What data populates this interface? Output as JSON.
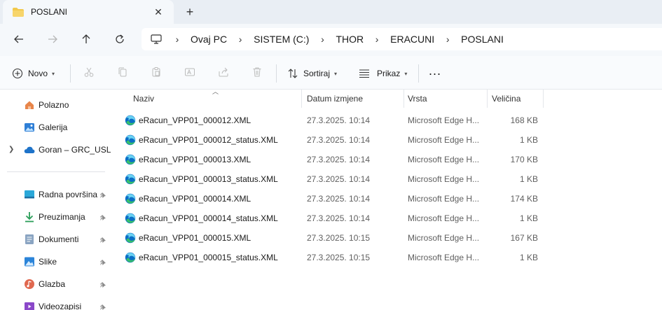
{
  "window": {
    "tab_title": "POSLANI"
  },
  "breadcrumb": {
    "items": [
      "Ovaj PC",
      "SISTEM (C:)",
      "THOR",
      "ERACUNI",
      "POSLANI"
    ]
  },
  "toolbar": {
    "new_label": "Novo",
    "sort_label": "Sortiraj",
    "view_label": "Prikaz",
    "more_label": "..."
  },
  "sidebar": {
    "items": [
      {
        "label": "Polazno",
        "icon": "home-icon"
      },
      {
        "label": "Galerija",
        "icon": "gallery-icon"
      },
      {
        "label": "Goran – GRC_USLUGE",
        "icon": "onedrive-cloud-icon"
      },
      {
        "label": "Radna površina",
        "icon": "desktop-icon"
      },
      {
        "label": "Preuzimanja",
        "icon": "download-icon"
      },
      {
        "label": "Dokumenti",
        "icon": "document-icon"
      },
      {
        "label": "Slike",
        "icon": "pictures-icon"
      },
      {
        "label": "Glazba",
        "icon": "music-icon"
      },
      {
        "label": "Videozapisi",
        "icon": "video-icon"
      }
    ]
  },
  "columns": {
    "name": "Naziv",
    "date": "Datum izmjene",
    "type": "Vrsta",
    "size": "Veličina"
  },
  "files": [
    {
      "name": "eRacun_VPP01_000012.XML",
      "date": "27.3.2025. 10:14",
      "type": "Microsoft Edge H...",
      "size": "168 KB"
    },
    {
      "name": "eRacun_VPP01_000012_status.XML",
      "date": "27.3.2025. 10:14",
      "type": "Microsoft Edge H...",
      "size": "1 KB"
    },
    {
      "name": "eRacun_VPP01_000013.XML",
      "date": "27.3.2025. 10:14",
      "type": "Microsoft Edge H...",
      "size": "170 KB"
    },
    {
      "name": "eRacun_VPP01_000013_status.XML",
      "date": "27.3.2025. 10:14",
      "type": "Microsoft Edge H...",
      "size": "1 KB"
    },
    {
      "name": "eRacun_VPP01_000014.XML",
      "date": "27.3.2025. 10:14",
      "type": "Microsoft Edge H...",
      "size": "174 KB"
    },
    {
      "name": "eRacun_VPP01_000014_status.XML",
      "date": "27.3.2025. 10:14",
      "type": "Microsoft Edge H...",
      "size": "1 KB"
    },
    {
      "name": "eRacun_VPP01_000015.XML",
      "date": "27.3.2025. 10:15",
      "type": "Microsoft Edge H...",
      "size": "167 KB"
    },
    {
      "name": "eRacun_VPP01_000015_status.XML",
      "date": "27.3.2025. 10:15",
      "type": "Microsoft Edge H...",
      "size": "1 KB"
    }
  ],
  "colors": {
    "tabstrip_bg": "#e9eef4",
    "accent_folder": "#f2c94c",
    "edge_blue": "#0c6ec6",
    "edge_green": "#37c06a"
  }
}
